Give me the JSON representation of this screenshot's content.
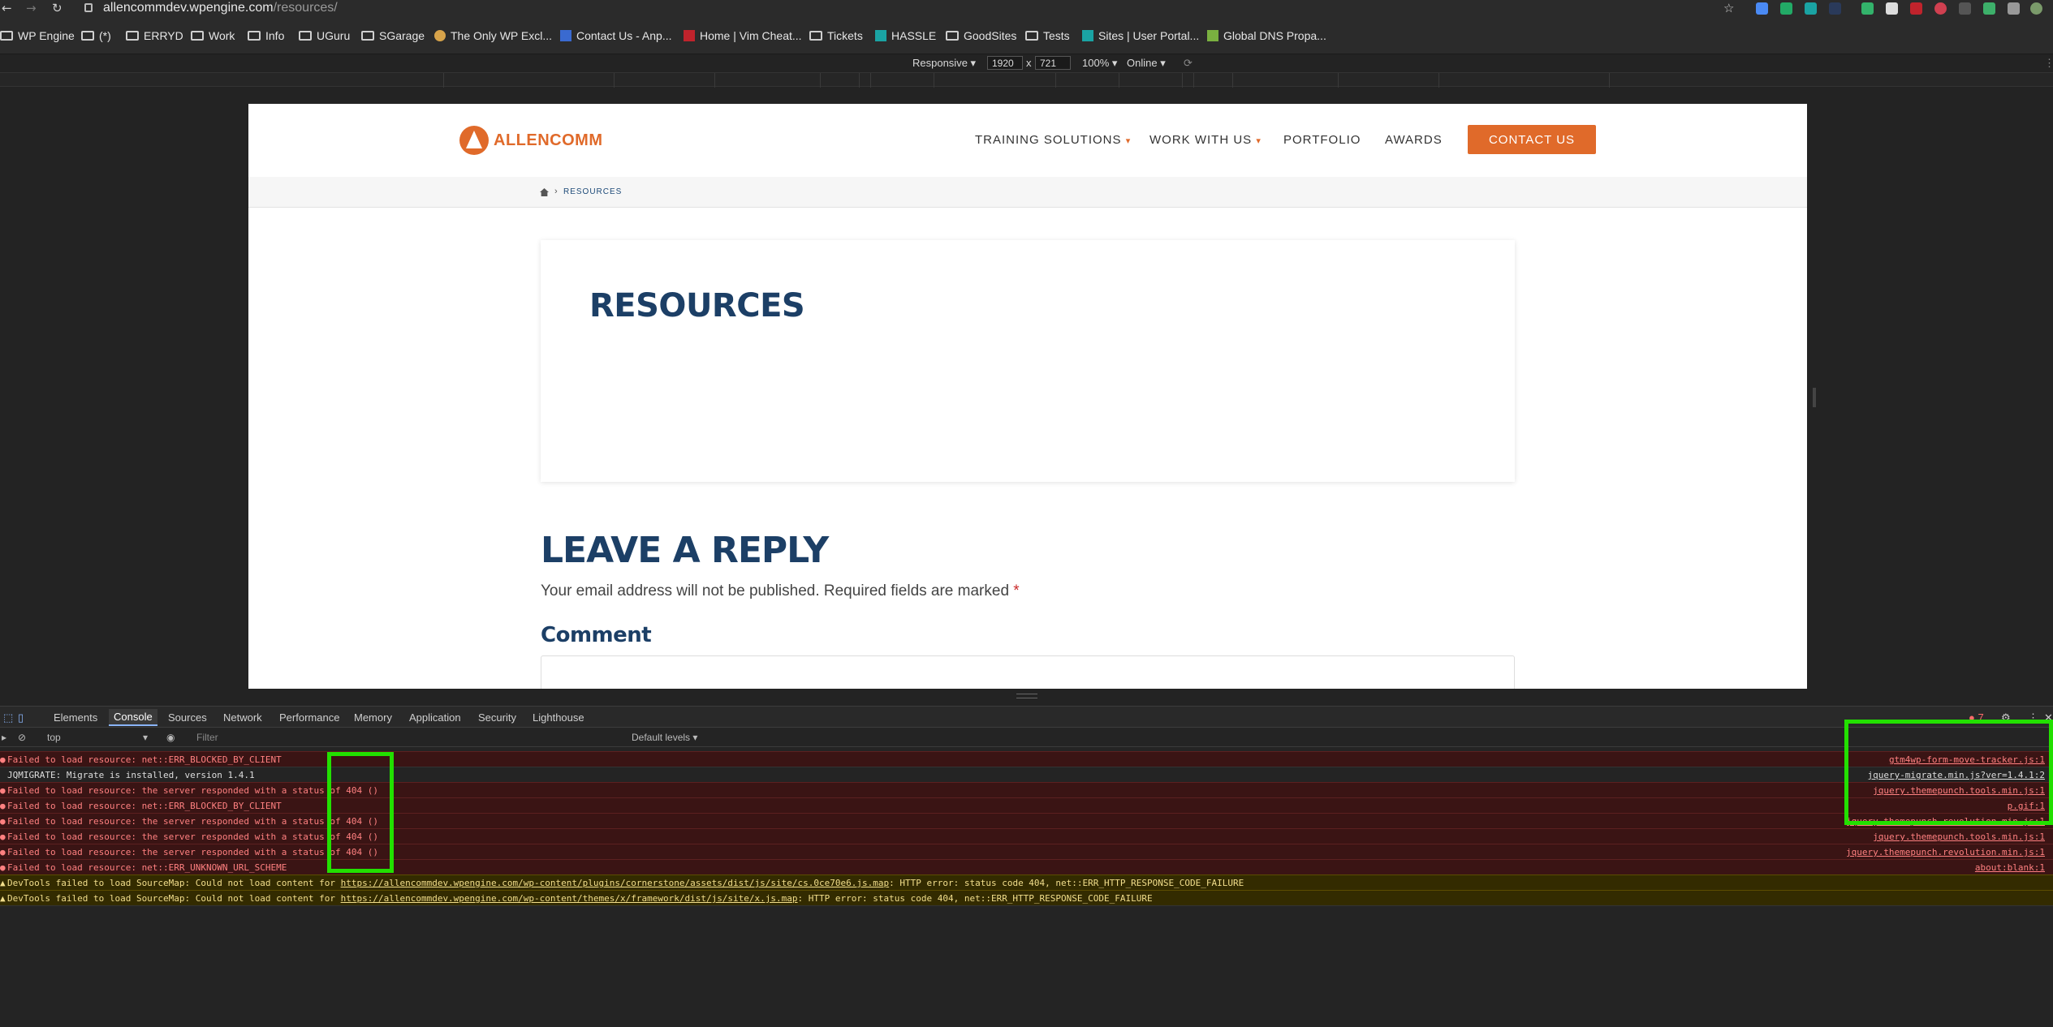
{
  "browser": {
    "url_host": "allencommdev.wpengine.com",
    "url_path": "/resources/",
    "bookmarks": [
      "WP Engine",
      "(*)",
      "ERRYD",
      "Work",
      "Info",
      "UGuru",
      "SGarage",
      "The Only WP Excl...",
      "Contact Us - Anp...",
      "Home | Vim Cheat...",
      "Tickets",
      "HASSLE",
      "GoodSites",
      "Tests",
      "Sites | User Portal...",
      "Global DNS Propa..."
    ]
  },
  "responsive": {
    "device": "Responsive ▾",
    "width": "1920",
    "times": "x",
    "height": "721",
    "zoom": "100% ▾",
    "throttle": "Online ▾"
  },
  "site": {
    "logo_text": "ALLENCOMM",
    "menu": [
      "TRAINING SOLUTIONS",
      "WORK WITH US",
      "PORTFOLIO",
      "AWARDS"
    ],
    "cta": "CONTACT US",
    "breadcrumb_sep": "›",
    "breadcrumb_current": "RESOURCES",
    "page_title": "RESOURCES",
    "reply_heading": "LEAVE A REPLY",
    "reply_note": "Your email address will not be published. Required fields are marked",
    "required_mark": "*",
    "comment_label": "Comment"
  },
  "devtools": {
    "tabs": [
      "Elements",
      "Console",
      "Sources",
      "Network",
      "Performance",
      "Memory",
      "Application",
      "Security",
      "Lighthouse"
    ],
    "error_count": "7",
    "context": "top",
    "filter_placeholder": "Filter",
    "levels": "Default levels ▾",
    "messages": [
      {
        "level": "error",
        "text": "Failed to load resource: net::ERR_BLOCKED_BY_CLIENT",
        "source": "gtm4wp-form-move-tracker.js:1"
      },
      {
        "level": "info",
        "text": "JQMIGRATE: Migrate is installed, version 1.4.1",
        "source": "jquery-migrate.min.js?ver=1.4.1:2"
      },
      {
        "level": "error",
        "text": "Failed to load resource: the server responded with a status of 404 ()",
        "source": "jquery.themepunch.tools.min.js:1"
      },
      {
        "level": "error",
        "text": "Failed to load resource: net::ERR_BLOCKED_BY_CLIENT",
        "source": "p.gif:1"
      },
      {
        "level": "error",
        "text": "Failed to load resource: the server responded with a status of 404 ()",
        "source": "jquery.themepunch.revolution.min.js:1"
      },
      {
        "level": "error",
        "text": "Failed to load resource: the server responded with a status of 404 ()",
        "source": "jquery.themepunch.tools.min.js:1"
      },
      {
        "level": "error",
        "text": "Failed to load resource: the server responded with a status of 404 ()",
        "source": "jquery.themepunch.revolution.min.js:1"
      },
      {
        "level": "error",
        "text": "Failed to load resource: net::ERR_UNKNOWN_URL_SCHEME",
        "source": "about:blank:1"
      }
    ],
    "warnings": [
      {
        "prefix": "DevTools failed to load SourceMap: Could not load content for ",
        "link": "https://allencommdev.wpengine.com/wp-content/plugins/cornerstone/assets/dist/js/site/cs.0ce70e6.js.map",
        "suffix": ": HTTP error: status code 404, net::ERR_HTTP_RESPONSE_CODE_FAILURE"
      },
      {
        "prefix": "DevTools failed to load SourceMap: Could not load content for ",
        "link": "https://allencommdev.wpengine.com/wp-content/themes/x/framework/dist/js/site/x.js.map",
        "suffix": ": HTTP error: status code 404, net::ERR_HTTP_RESPONSE_CODE_FAILURE"
      }
    ]
  },
  "colors": {
    "brand_orange": "#e06a2a",
    "heading_navy": "#1c3f66",
    "highlight_green": "#22e000"
  }
}
